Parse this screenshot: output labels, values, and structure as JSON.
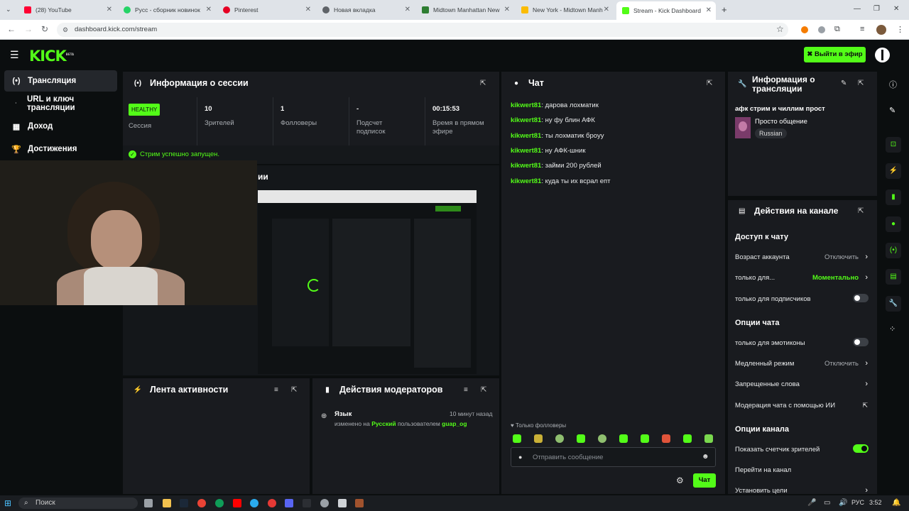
{
  "browser": {
    "tabs": [
      {
        "title": "(28) YouTube",
        "color": "#ff0033"
      },
      {
        "title": "Русс - сборник новинок",
        "color": "#25d366"
      },
      {
        "title": "Pinterest",
        "color": "#e60023"
      },
      {
        "title": "Новая вкладка",
        "color": "#5f6368"
      },
      {
        "title": "Midtown Manhattan New",
        "color": "#2e7d32"
      },
      {
        "title": "New York - Midtown Manh",
        "color": "#fbbc04"
      },
      {
        "title": "Stream - Kick Dashboard",
        "color": "#53fc18"
      }
    ],
    "url": "dashboard.kick.com/stream"
  },
  "header": {
    "logo": "KICK",
    "logo_badge": "BETA",
    "go_live": "Выйти в эфир"
  },
  "sidebar": {
    "items": [
      {
        "label": "Трансляция",
        "icon": "broadcast-icon"
      },
      {
        "label": "URL и ключ трансляции",
        "icon": "key-icon"
      },
      {
        "label": "Доход",
        "icon": "income-icon"
      },
      {
        "label": "Достижения",
        "icon": "trophy-icon"
      }
    ]
  },
  "session": {
    "title": "Информация о сессии",
    "health_badge": "HEALTHY",
    "health_label": "Сессия",
    "stats": [
      {
        "value": "10",
        "label": "Зрителей"
      },
      {
        "value": "1",
        "label": "Фолловеры"
      },
      {
        "value": "-",
        "label": "Подсчет подписок"
      },
      {
        "value": "00:15:53",
        "label": "Время в прямом эфире"
      }
    ],
    "success_message": "Стрим успешно запущен.",
    "preview_title_fragment": "ии"
  },
  "activity": {
    "title": "Лента активности"
  },
  "moderators": {
    "title": "Действия модераторов",
    "entries": [
      {
        "title": "Язык",
        "time": "10 минут назад",
        "prefix": "изменено на",
        "value": "Русский",
        "middle": "пользователем",
        "user": "guap_og"
      }
    ]
  },
  "chat": {
    "title": "Чат",
    "messages": [
      {
        "user": "kikwert81",
        "text": "дарова лохматик"
      },
      {
        "user": "kikwert81",
        "text": "ну фу блин АФК"
      },
      {
        "user": "kikwert81",
        "text": "ты лохматик броуу"
      },
      {
        "user": "kikwert81",
        "text": "ну АФК-шник"
      },
      {
        "user": "kikwert81",
        "text": "займи 200 рублей"
      },
      {
        "user": "kikwert81",
        "text": "куда ты их всрал епт"
      }
    ],
    "followers_only": "Только фолловеры",
    "placeholder": "Отправить сообщение",
    "send": "Чат"
  },
  "stream_info": {
    "title": "Информация о трансляции",
    "stream_title": "афк стрим и чиллим прост",
    "category": "Просто общение",
    "language": "Russian"
  },
  "channel_actions": {
    "title": "Действия на канале",
    "chat_access": "Доступ к чату",
    "account_age": {
      "label": "Возраст аккаунта",
      "value": "Отключить"
    },
    "followers_only": {
      "label": "только для...",
      "value": "Моментально"
    },
    "subscribers_only": {
      "label": "только для подписчиков",
      "on": false
    },
    "chat_options": "Опции чата",
    "emotes_only": {
      "label": "только для эмотиконы",
      "on": false
    },
    "slow_mode": {
      "label": "Медленный режим",
      "value": "Отключить"
    },
    "banned_words": {
      "label": "Запрещенные слова"
    },
    "ai_moderation": {
      "label": "Модерация чата с помощью ИИ"
    },
    "channel_options": "Опции канала",
    "show_viewers": {
      "label": "Показать счетчик зрителей",
      "on": true
    },
    "go_to_channel": {
      "label": "Перейти на канал"
    },
    "set_goals": {
      "label": "Установить цели"
    }
  },
  "taskbar": {
    "search": "Поиск",
    "lang": "РУС",
    "time": "3:52"
  }
}
